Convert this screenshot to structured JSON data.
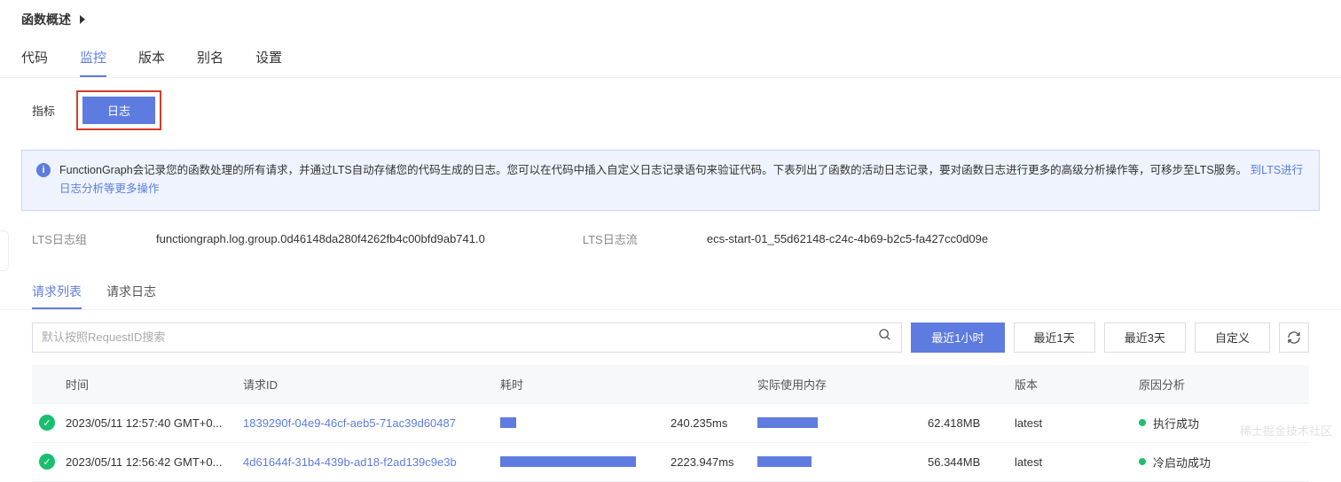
{
  "header": {
    "title": "函数概述"
  },
  "main_tabs": [
    {
      "label": "代码"
    },
    {
      "label": "监控",
      "active": true
    },
    {
      "label": "版本"
    },
    {
      "label": "别名"
    },
    {
      "label": "设置"
    }
  ],
  "monitor_subtabs": {
    "metrics_label": "指标",
    "logs_label": "日志",
    "active": "logs"
  },
  "info_banner": {
    "text": "FunctionGraph会记录您的函数处理的所有请求，并通过LTS自动存储您的代码生成的日志。您可以在代码中插入自定义日志记录语句来验证代码。下表列出了函数的活动日志记录，要对函数日志进行更多的高级分析操作等，可移步至LTS服务。",
    "link": "到LTS进行日志分析等更多操作"
  },
  "log_group": {
    "label": "LTS日志组",
    "value": "functiongraph.log.group.0d46148da280f4262fb4c00bfd9ab741.0"
  },
  "log_stream": {
    "label": "LTS日志流",
    "value": "ecs-start-01_55d62148-c24c-4b69-b2c5-fa427cc0d09e"
  },
  "list_tabs": [
    {
      "label": "请求列表",
      "active": true
    },
    {
      "label": "请求日志"
    }
  ],
  "search": {
    "placeholder": "默认按照RequestID搜索"
  },
  "time_range": [
    {
      "label": "最近1小时",
      "active": true
    },
    {
      "label": "最近1天"
    },
    {
      "label": "最近3天"
    },
    {
      "label": "自定义"
    }
  ],
  "columns": {
    "time": "时间",
    "request_id": "请求ID",
    "duration": "耗时",
    "memory": "实际使用内存",
    "version": "版本",
    "reason": "原因分析"
  },
  "rows": [
    {
      "status": "success",
      "time": "2023/05/11 12:57:40 GMT+0...",
      "request_id": "1839290f-04e9-46cf-aeb5-71ac39d60487",
      "duration_ms": "240.235ms",
      "duration_pct": 10,
      "memory_mb": "62.418MB",
      "memory_pct": 38,
      "version": "latest",
      "reason": "执行成功"
    },
    {
      "status": "success",
      "time": "2023/05/11 12:56:42 GMT+0...",
      "request_id": "4d61644f-31b4-439b-ad18-f2ad139c9e3b",
      "duration_ms": "2223.947ms",
      "duration_pct": 85,
      "memory_mb": "56.344MB",
      "memory_pct": 34,
      "version": "latest",
      "reason": "冷启动成功"
    }
  ],
  "watermark": "稀土掘金技术社区"
}
